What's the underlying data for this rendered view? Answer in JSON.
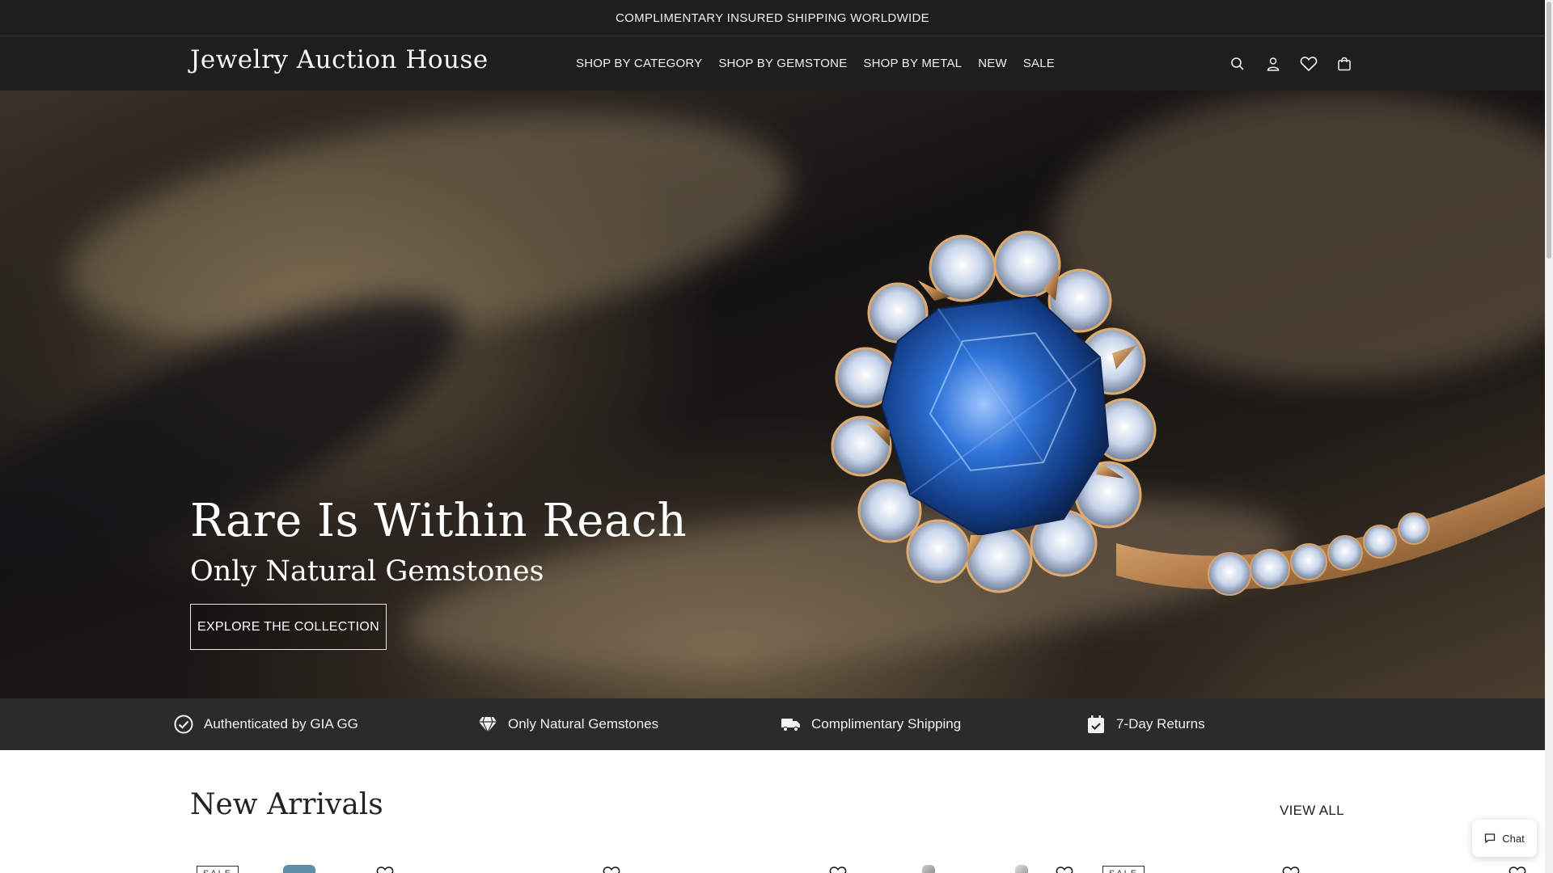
{
  "announcement": "COMPLIMENTARY INSURED SHIPPING WORLDWIDE",
  "header": {
    "logo": "Jewelry Auction House",
    "nav": [
      "SHOP BY CATEGORY",
      "SHOP BY GEMSTONE",
      "SHOP BY METAL",
      "NEW",
      "SALE"
    ],
    "icons": [
      "search-icon",
      "account-icon",
      "wishlist-heart-icon",
      "cart-bag-icon"
    ]
  },
  "hero": {
    "title": "Rare Is Within Reach",
    "subtitle": "Only Natural Gemstones",
    "cta": "EXPLORE THE COLLECTION"
  },
  "trust": [
    {
      "icon": "check-circle-icon",
      "label": "Authenticated by GIA GG"
    },
    {
      "icon": "diamond-icon",
      "label": "Only Natural Gemstones"
    },
    {
      "icon": "truck-icon",
      "label": "Complimentary Shipping"
    },
    {
      "icon": "calendar-check-icon",
      "label": "7-Day Returns"
    }
  ],
  "arrivals": {
    "title": "New Arrivals",
    "view_all": "VIEW ALL",
    "cards": [
      {
        "badge": "SALE"
      },
      {
        "badge": ""
      },
      {
        "badge": ""
      },
      {
        "badge": ""
      },
      {
        "badge": "SALE"
      },
      {
        "badge": ""
      }
    ]
  },
  "chat": {
    "label": "Chat"
  },
  "colors": {
    "header_bg": "#1e1e1e",
    "trust_bg": "#2b2b2b",
    "sapphire": "#2a6fd6",
    "gold": "#d9a36a"
  }
}
